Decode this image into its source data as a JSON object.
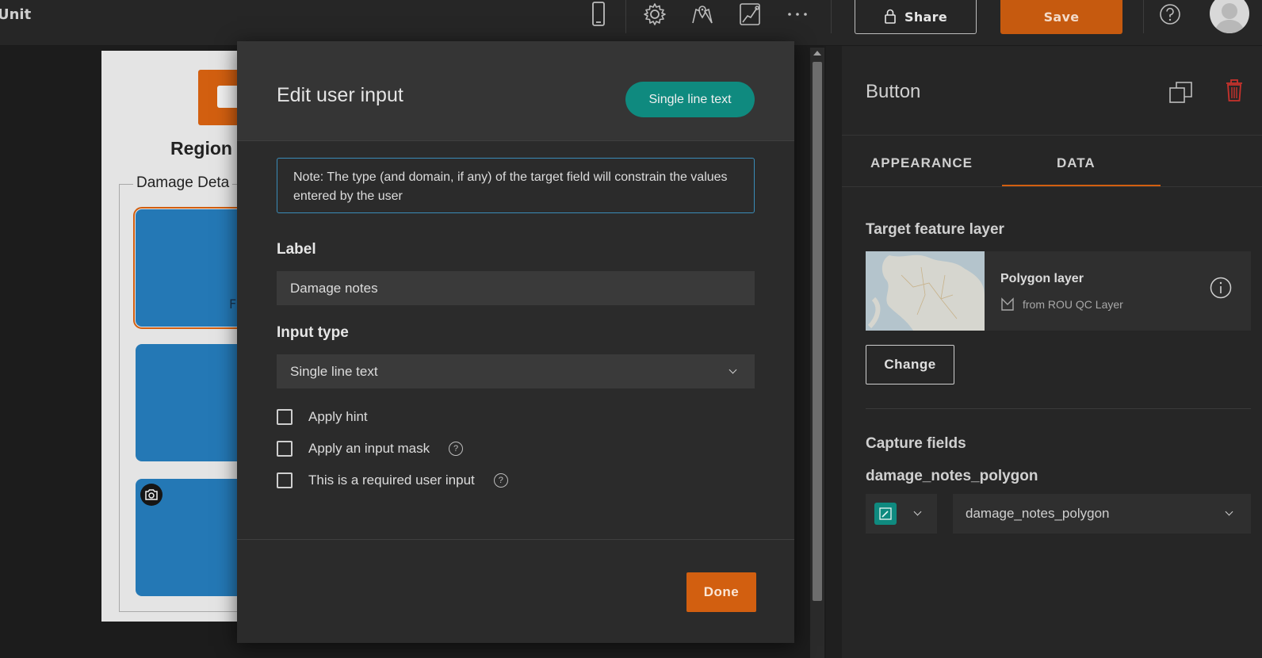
{
  "app": {
    "title_fragment": "Unit"
  },
  "toolbar": {
    "share_label": "Share",
    "save_label": "Save"
  },
  "canvas": {
    "form_title_fragment": "Region",
    "group_label_fragment": "Damage Deta",
    "tile_letter": "F"
  },
  "modal": {
    "title": "Edit user input",
    "type_pill": "Single line text",
    "note": "Note: The type (and domain, if any) of the target field will constrain the values entered by the user",
    "label_heading": "Label",
    "label_value": "Damage notes",
    "input_type_heading": "Input type",
    "input_type_value": "Single line text",
    "options": [
      {
        "label": "Apply hint",
        "checked": false,
        "help": false
      },
      {
        "label": "Apply an input mask",
        "checked": false,
        "help": true
      },
      {
        "label": "This is a required user input",
        "checked": false,
        "help": true
      }
    ],
    "done_label": "Done"
  },
  "panel": {
    "title": "Button",
    "tabs": [
      {
        "label": "APPEARANCE",
        "active": false
      },
      {
        "label": "DATA",
        "active": true
      }
    ],
    "target_layer_heading": "Target feature layer",
    "layer_name": "Polygon layer",
    "layer_source": "from ROU QC Layer",
    "change_label": "Change",
    "capture_heading": "Capture fields",
    "field_name": "damage_notes_polygon",
    "field_select_value": "damage_notes_polygon"
  },
  "colors": {
    "accent_orange": "#d25f10",
    "accent_teal": "#0f8a7f",
    "note_border": "#3a8cb8"
  }
}
